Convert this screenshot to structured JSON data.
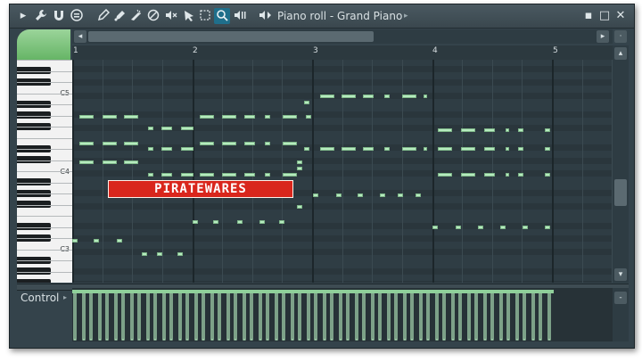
{
  "window": {
    "title": "Piano roll - Grand Piano"
  },
  "toolbar": [
    {
      "name": "menu-arrow-icon",
      "glyph": "▸"
    },
    {
      "name": "wrench-icon",
      "glyph": "🔧"
    },
    {
      "name": "magnet-icon",
      "glyph": "∩"
    },
    {
      "name": "stamp-icon",
      "glyph": "⊜"
    },
    {
      "name": "pencil-icon",
      "glyph": "✎"
    },
    {
      "name": "paint-brush-icon",
      "glyph": "✍"
    },
    {
      "name": "slice-icon",
      "glyph": "✂"
    },
    {
      "name": "delete-icon",
      "glyph": "⊘"
    },
    {
      "name": "mute-icon",
      "glyph": "◁×"
    },
    {
      "name": "slip-icon",
      "glyph": "◣"
    },
    {
      "name": "select-icon",
      "glyph": "⛶"
    },
    {
      "name": "zoom-icon",
      "glyph": "🔍"
    },
    {
      "name": "playback-icon",
      "glyph": "◀|"
    }
  ],
  "window_controls": {
    "minimize": "▪",
    "maximize": "□",
    "close": "✕"
  },
  "title_arrow": "▸",
  "speaker_icon": "◁▸",
  "ruler": {
    "bars": [
      "1",
      "2",
      "3",
      "4",
      "5"
    ]
  },
  "keyboard": {
    "labels": [
      "C5",
      "C4",
      "C3"
    ]
  },
  "watermark": "PIRATEWARES",
  "control": {
    "label": "Control",
    "arrow": "▸"
  },
  "scroll": {
    "left": "◂",
    "right": "▸",
    "up": "▴",
    "down": "▾",
    "pan": "·",
    "ctl": "-"
  }
}
